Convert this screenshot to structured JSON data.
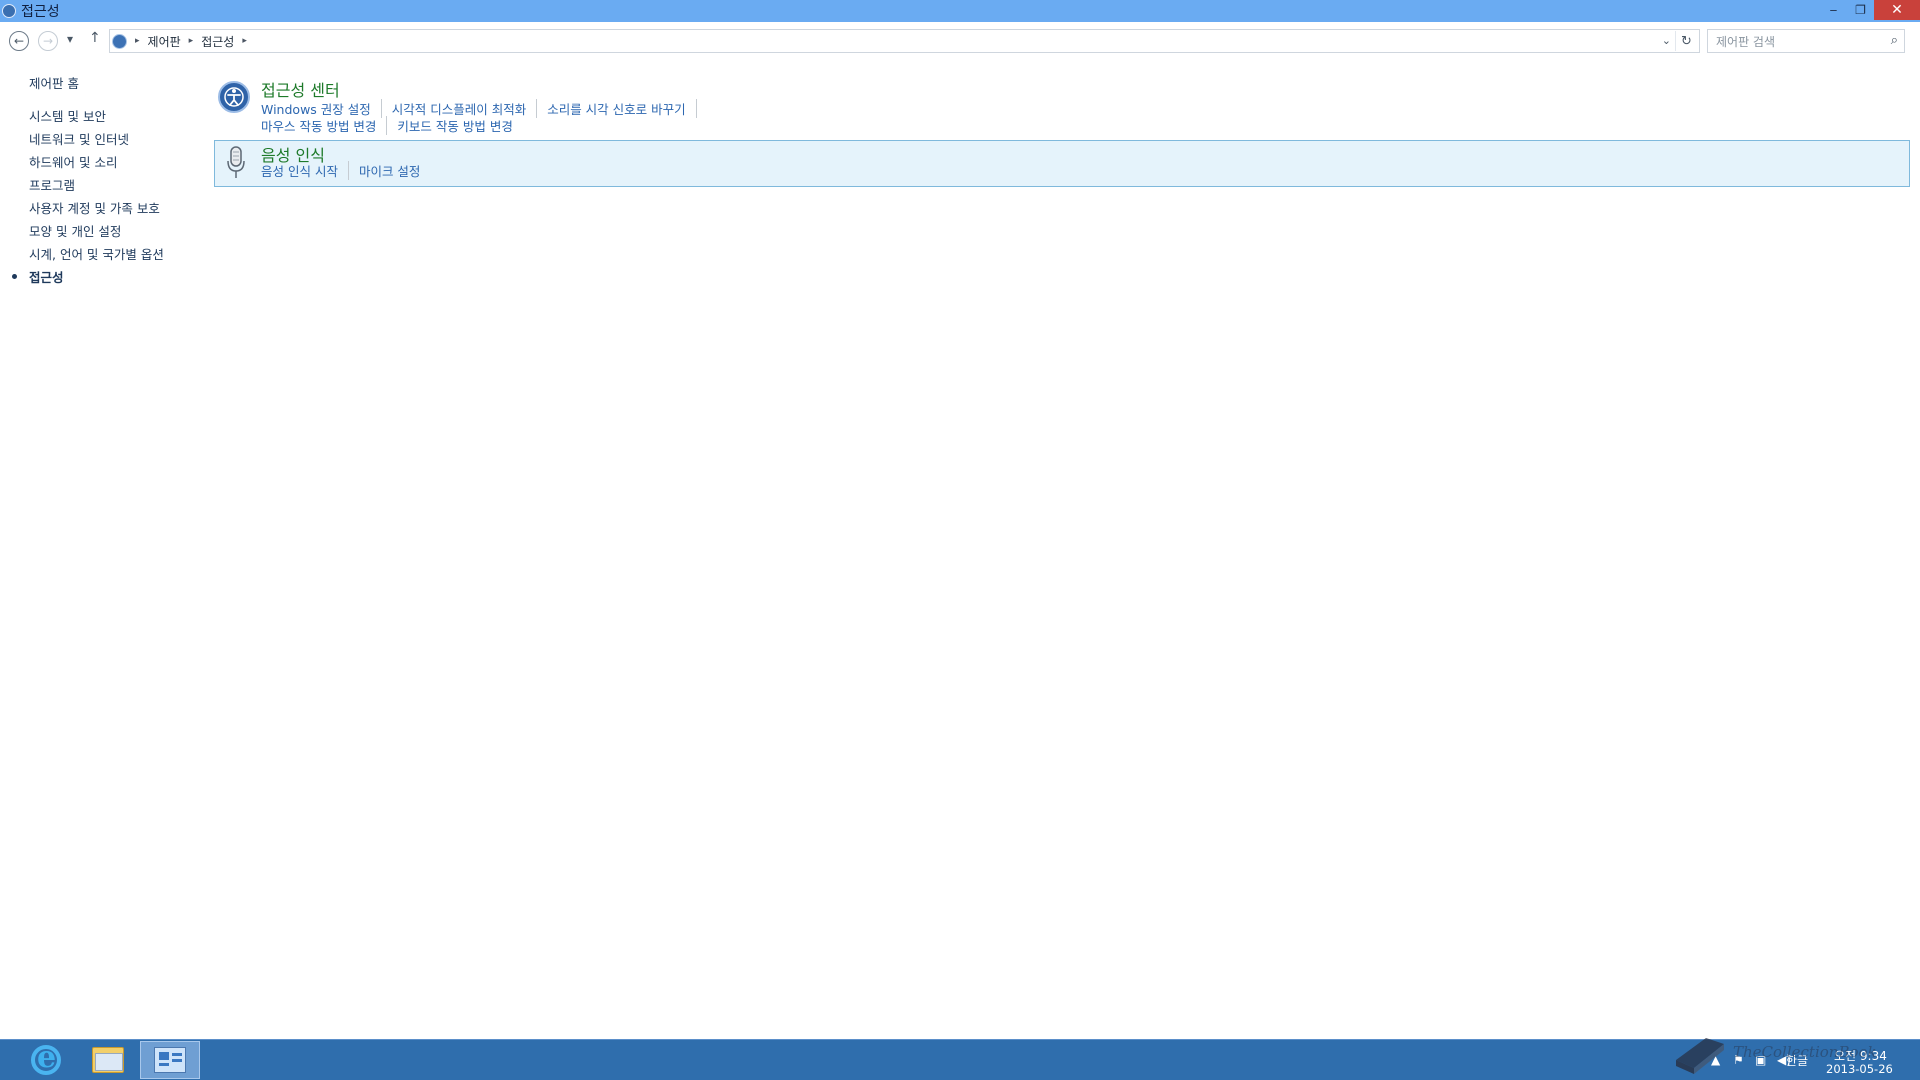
{
  "window": {
    "title": "접근성",
    "minimize": "‒",
    "restore": "❐",
    "close": "✕"
  },
  "nav": {
    "back": "←",
    "forward": "→",
    "history_dropdown": "▾",
    "up": "↑",
    "breadcrumb": [
      "제어판",
      "접근성"
    ],
    "address_dropdown": "⌄",
    "refresh": "↻",
    "search_placeholder": "제어판 검색",
    "search_icon": "⌕"
  },
  "sidebar": {
    "home": "제어판 홈",
    "items": [
      "시스템 및 보안",
      "네트워크 및 인터넷",
      "하드웨어 및 소리",
      "프로그램",
      "사용자 계정 및 가족 보호",
      "모양 및 개인 설정",
      "시계, 언어 및 국가별 옵션",
      "접근성"
    ],
    "current_index": 7
  },
  "categories": [
    {
      "title": "접근성 센터",
      "icon": "ease-of-access-icon",
      "links_row1": [
        "Windows 권장 설정",
        "시각적 디스플레이 최적화",
        "소리를 시각 신호로 바꾸기"
      ],
      "links_row2": [
        "마우스 작동 방법 변경",
        "키보드 작동 방법 변경"
      ]
    },
    {
      "title": "음성 인식",
      "icon": "microphone-icon",
      "links_row1": [
        "음성 인식 시작",
        "마이크 설정"
      ],
      "selected": true
    }
  ],
  "taskbar": {
    "apps": [
      "internet-explorer",
      "file-explorer",
      "control-panel"
    ],
    "active_app": "control-panel",
    "ime": "한글",
    "time": "오전 9:34",
    "date": "2013-05-26",
    "watermark": "TheCollectionBook"
  },
  "colors": {
    "titlebar": "#6aabf2",
    "close_button": "#c9413b",
    "taskbar": "#2f6ead",
    "link": "#2d67b0",
    "category_title": "#1e7a2a",
    "selection_bg": "#e5f3fb"
  }
}
